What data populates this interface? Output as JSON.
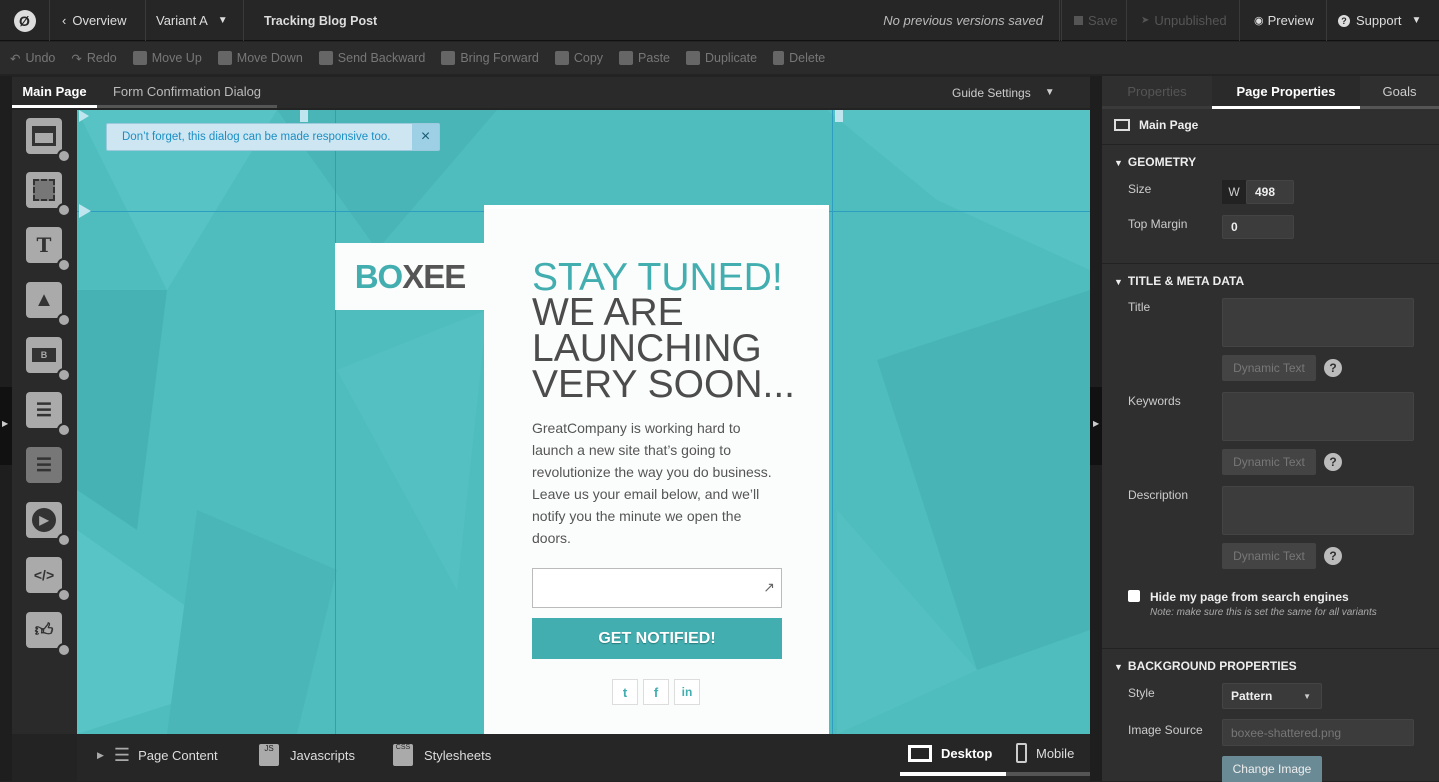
{
  "topbar": {
    "logo": "Ø",
    "overview": "Overview",
    "variant": "Variant A",
    "page_title": "Tracking Blog Post",
    "versions": "No previous versions saved",
    "save": "Save",
    "unpublished": "Unpublished",
    "preview": "Preview",
    "support": "Support"
  },
  "toolbar": {
    "undo": "Undo",
    "redo": "Redo",
    "move_up": "Move Up",
    "move_down": "Move Down",
    "send_backward": "Send Backward",
    "bring_forward": "Bring Forward",
    "copy": "Copy",
    "paste": "Paste",
    "duplicate": "Duplicate",
    "delete": "Delete"
  },
  "editor_tabs": {
    "main_page": "Main Page",
    "form_confirmation": "Form Confirmation Dialog",
    "guide_settings": "Guide Settings"
  },
  "canvas": {
    "notice": "Don’t forget, this dialog can be made responsive too.",
    "notice_close": "×",
    "logo_part1": "BO",
    "logo_part2": "XEE",
    "headline1": "STAY TUNED!",
    "headline2": "WE ARE",
    "headline3": "LAUNCHING",
    "headline4": "VERY SOON...",
    "body": "GreatCompany is working hard to launch a new site that’s going to revolutionize the way you do business. Leave us your email below, and we’ll notify you the minute we open the doors.",
    "email_value": "",
    "cta": "GET NOTIFIED!",
    "social_twitter": "t",
    "social_facebook": "f",
    "social_linkedin": "in",
    "bg_color": "#4fbdbe",
    "accent": "#43aeb0"
  },
  "right_panel": {
    "tabs": [
      "Properties",
      "Page Properties",
      "Goals"
    ],
    "page_name": "Main Page",
    "geometry": {
      "heading": "GEOMETRY",
      "size_label": "Size",
      "w_label": "W",
      "width": "498",
      "top_margin_label": "Top Margin",
      "top_margin": "0"
    },
    "meta": {
      "heading": "TITLE & META DATA",
      "title_label": "Title",
      "keywords_label": "Keywords",
      "description_label": "Description",
      "dynamic_text": "Dynamic Text",
      "help": "?",
      "hide_label": "Hide my page from search engines",
      "hide_note": "Note: make sure this is set the same for all variants"
    },
    "background": {
      "heading": "BACKGROUND PROPERTIES",
      "style_label": "Style",
      "style_value": "Pattern",
      "image_source_label": "Image Source",
      "image_source_placeholder": "boxee-shattered.png",
      "change_image": "Change Image"
    }
  },
  "bottombar": {
    "page_content": "Page Content",
    "javascripts": "Javascripts",
    "stylesheets": "Stylesheets",
    "desktop": "Desktop",
    "mobile": "Mobile"
  }
}
